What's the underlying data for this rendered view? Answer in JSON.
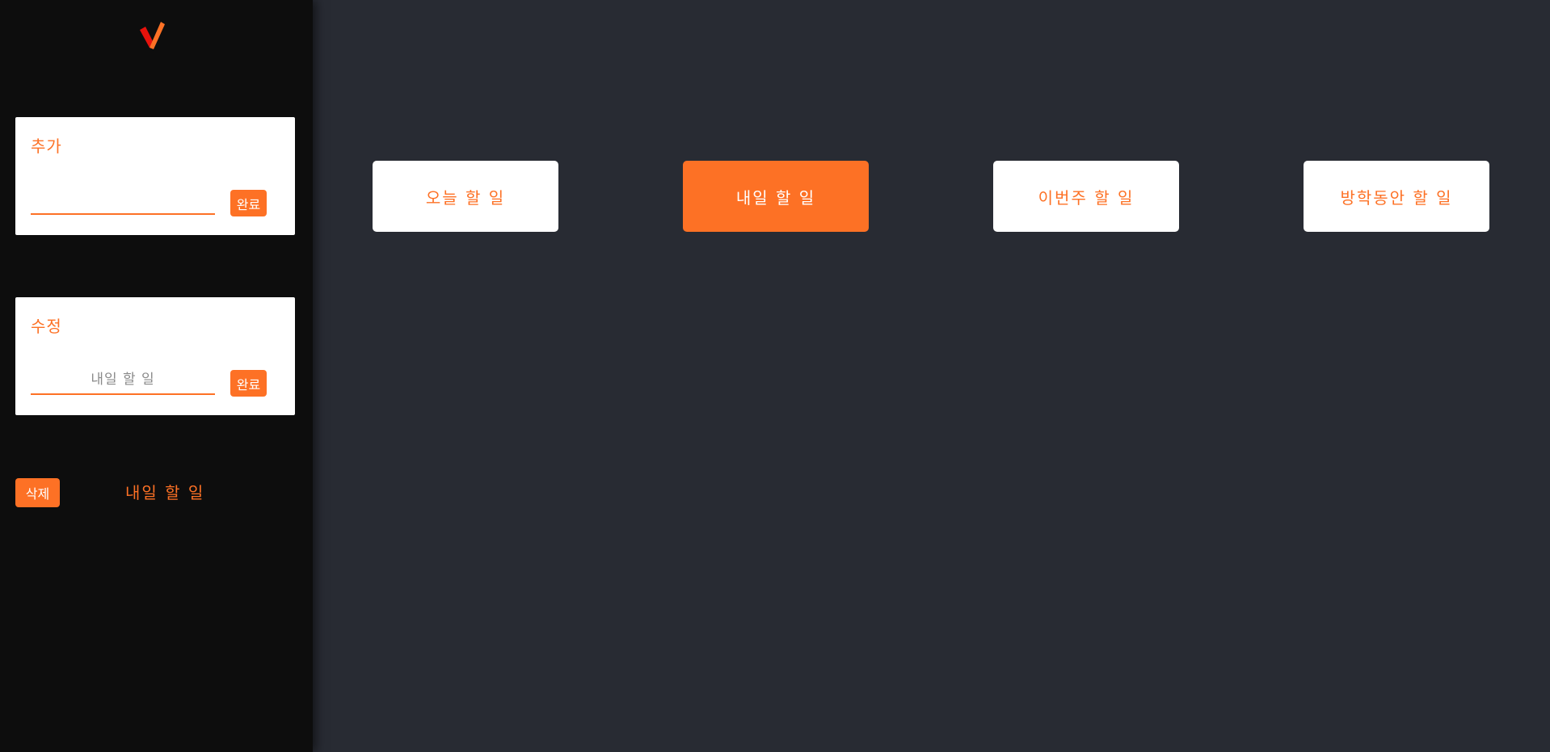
{
  "colors": {
    "accent": "#fd7125",
    "sidebar_bg": "#0d0d0d",
    "main_bg": "#282b33",
    "panel_bg": "#ffffff"
  },
  "logo": {
    "icon": "checkmark-logo"
  },
  "add_panel": {
    "title": "추가",
    "input_value": "",
    "input_placeholder": "",
    "done_label": "완료"
  },
  "edit_panel": {
    "title": "수정",
    "input_value": "",
    "input_placeholder": "내일 할 일",
    "done_label": "완료"
  },
  "delete_section": {
    "delete_label": "삭제",
    "selected_item": "내일 할 일"
  },
  "tabs": [
    {
      "label": "오늘 할 일",
      "active": false
    },
    {
      "label": "내일 할 일",
      "active": true
    },
    {
      "label": "이번주 할 일",
      "active": false
    },
    {
      "label": "방학동안 할 일",
      "active": false
    }
  ]
}
